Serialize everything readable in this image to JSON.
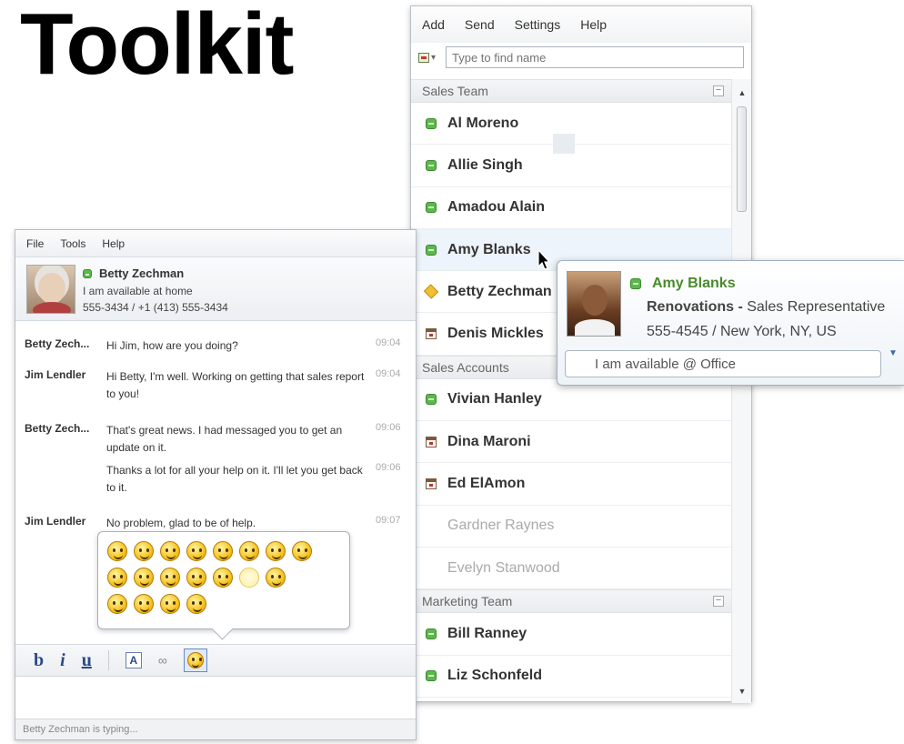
{
  "headline": "Toolkit",
  "contacts": {
    "menu": [
      "Add",
      "Send",
      "Settings",
      "Help"
    ],
    "search_placeholder": "Type to find name",
    "groups": [
      {
        "name": "Sales Team",
        "collapse": "−",
        "members": [
          {
            "name": "Al Moreno",
            "status": "available"
          },
          {
            "name": "Allie Singh",
            "status": "available"
          },
          {
            "name": "Amadou Alain",
            "status": "available"
          },
          {
            "name": "Amy Blanks",
            "status": "available"
          },
          {
            "name": "Betty Zechman",
            "status": "away"
          },
          {
            "name": "Denis Mickles",
            "status": "busy"
          }
        ]
      },
      {
        "name": "Sales Accounts",
        "members": [
          {
            "name": "Vivian Hanley",
            "status": "available"
          },
          {
            "name": "Dina Maroni",
            "status": "busy"
          },
          {
            "name": "Ed ElAmon",
            "status": "busy"
          },
          {
            "name": "Gardner Raynes",
            "status": "offline"
          },
          {
            "name": "Evelyn Stanwood",
            "status": "offline"
          }
        ]
      },
      {
        "name": "Marketing Team",
        "collapse": "−",
        "members": [
          {
            "name": "Bill Ranney",
            "status": "available"
          },
          {
            "name": "Liz Schonfeld",
            "status": "available"
          }
        ]
      }
    ],
    "scroll_up": "▲",
    "scroll_down": "▼"
  },
  "card": {
    "name": "Amy Blanks",
    "company": "Renovations - ",
    "role": "Sales Representative",
    "phone": "555-4545 / New York, NY, US",
    "status_message": "I am available @ Office",
    "expand": "▼"
  },
  "chat": {
    "menu": [
      "File",
      "Tools",
      "Help"
    ],
    "contact_name": "Betty Zechman",
    "contact_status": "I am available at home",
    "contact_phone": "555-3434 / +1 (413) 555-3434",
    "messages": [
      {
        "from": "Betty Zech...",
        "text": "Hi Jim, how are you doing?",
        "time": "09:04"
      },
      {
        "from": "Jim Lendler",
        "text": "Hi Betty, I'm well.  Working on getting that sales report to you!",
        "time": "09:04"
      },
      {
        "from": "Betty Zech...",
        "text": "That's great news. I had messaged you to get an update on it.",
        "time": "09:06"
      },
      {
        "from": "",
        "text": "Thanks a lot for all your help on it. I'll let you get back to it.",
        "time": "09:06"
      },
      {
        "from": "Jim Lendler",
        "text": "No problem, glad to be of help.",
        "time": "09:07"
      }
    ],
    "toolbar": {
      "bold": "b",
      "italic": "i",
      "underline": "u",
      "font": "A",
      "link": "∞"
    },
    "typing_status": "Betty Zechman is typing..."
  }
}
